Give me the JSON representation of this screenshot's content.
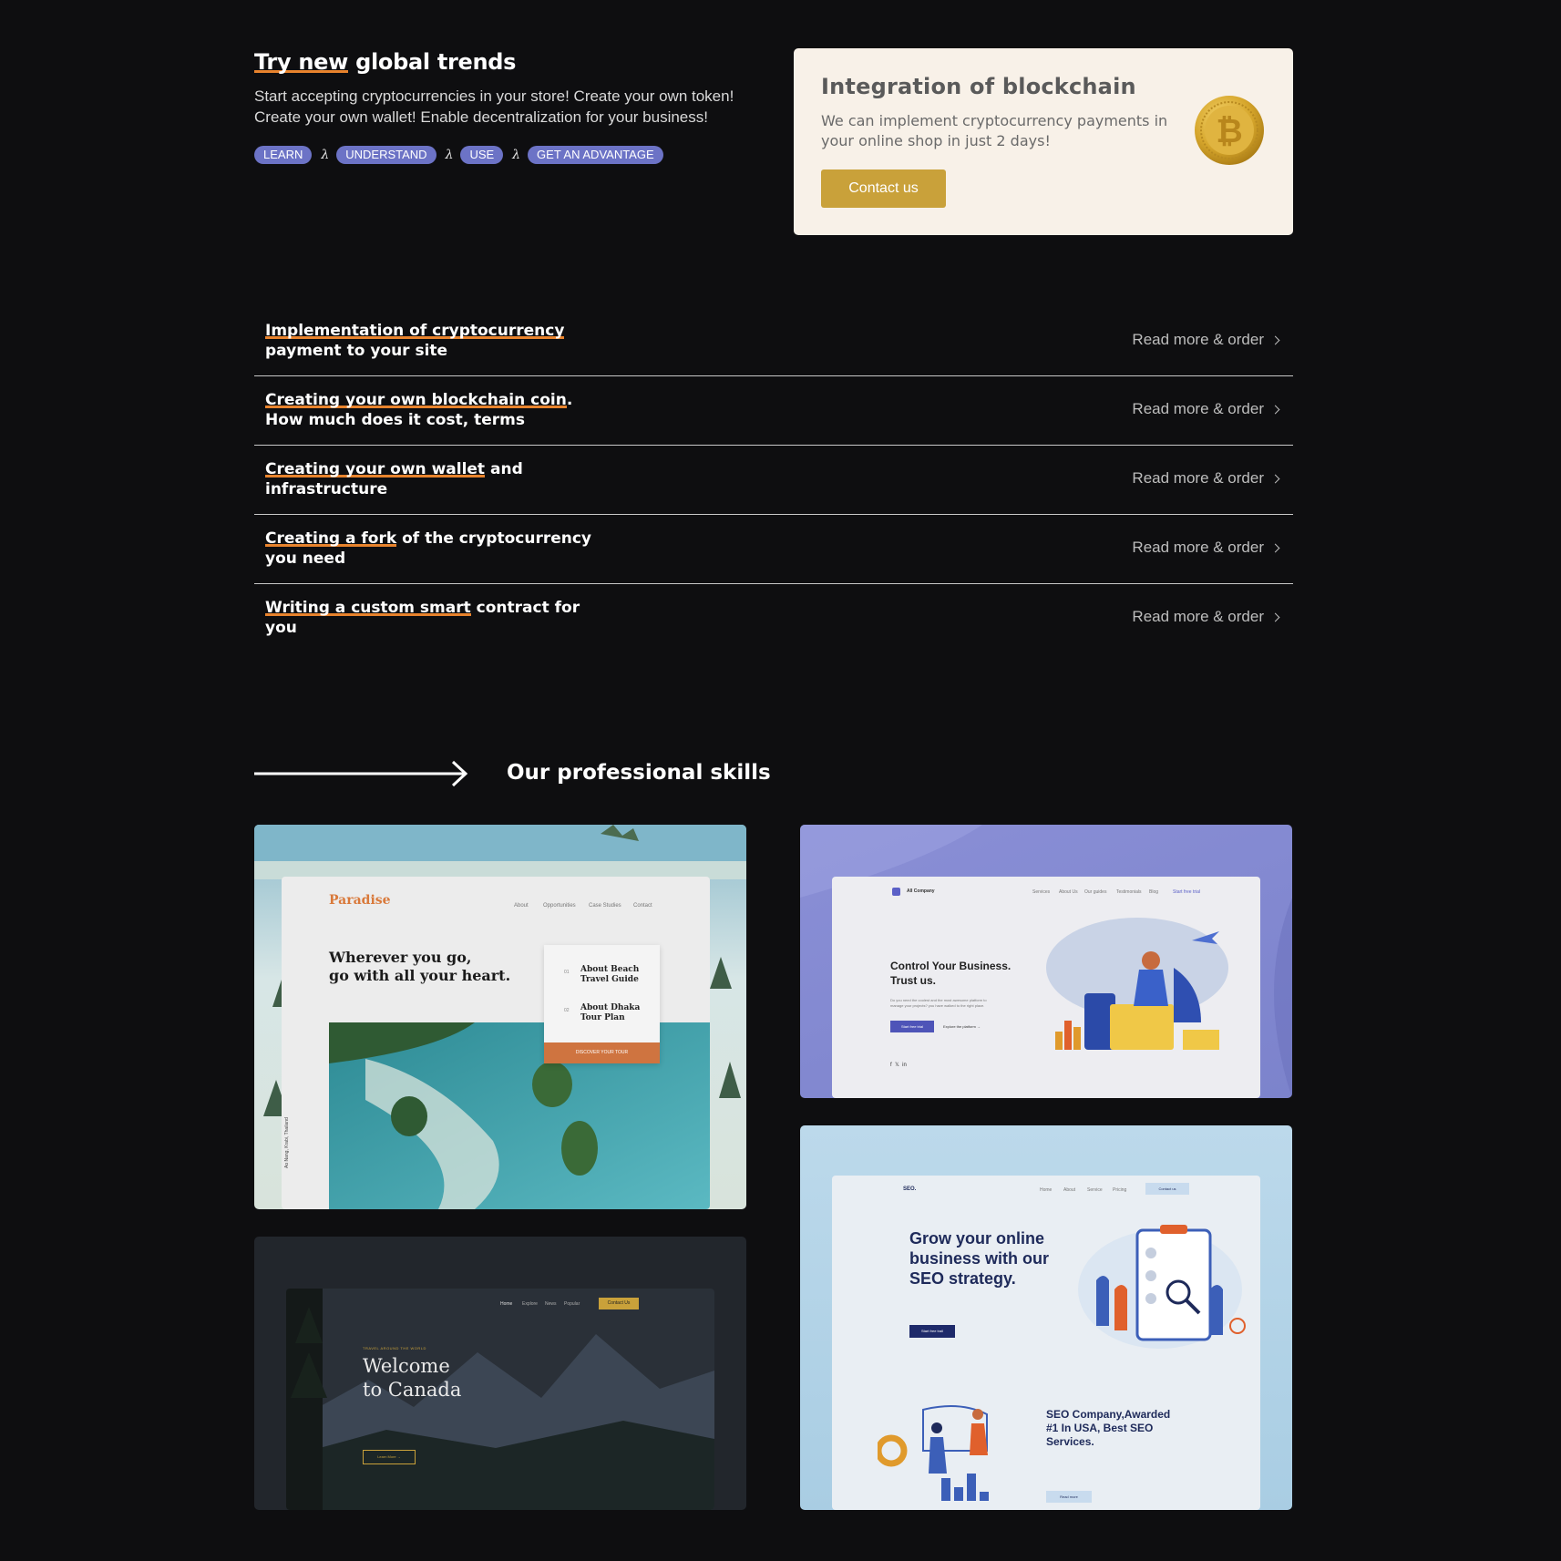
{
  "hero": {
    "title_highlight": "Try new",
    "title_rest": " global trends",
    "description": "Start accepting cryptocurrencies in your store! Create your own token! Create your own wallet! Enable decentralization for your business!",
    "tags": [
      "LEARN",
      "UNDERSTAND",
      "USE",
      "GET AN ADVANTAGE"
    ],
    "tag_separator": "λ"
  },
  "promo": {
    "title": "Integration of blockchain",
    "description": "We can implement cryptocurrency payments in your online shop in just 2 days!",
    "button_label": "Contact us",
    "coin_symbol": "₿",
    "coin_color": "#d6a62c"
  },
  "services": {
    "link_label": "Read more & order",
    "items": [
      {
        "highlight": "Implementation of cryptocurrency",
        "rest": " payment to your site"
      },
      {
        "highlight": "Creating your own blockchain coin",
        "rest": ". How much does it cost, terms"
      },
      {
        "highlight": "Creating your own wallet",
        "rest": " and infrastructure"
      },
      {
        "highlight": "Creating a fork",
        "rest": " of the cryptocurrency you need"
      },
      {
        "highlight": "Writing a custom smart",
        "rest": " contract for you"
      }
    ]
  },
  "skills": {
    "title": "Our professional skills",
    "paradise": {
      "brand": "Paradise",
      "nav": [
        "About",
        "Opportunities",
        "Case Studies",
        "Contact"
      ],
      "headline_1": "Wherever you go,",
      "headline_2": "go with all your heart.",
      "item1_num": "01",
      "item1_1": "About Beach",
      "item1_2": "Travel Guide",
      "item2_num": "02",
      "item2_1": "About Dhaka",
      "item2_2": "Tour Plan",
      "cta": "DISCOVER YOUR TOUR",
      "location": "Ao Nang, Krabi, Thailand"
    },
    "company": {
      "brand": "All Company",
      "nav": [
        "Services",
        "About Us",
        "Our guides",
        "Testimonials",
        "Blog"
      ],
      "nav_cta": "Start free trial",
      "headline_1": "Control Your Business.",
      "headline_2": "Trust us.",
      "sub": "Do you need the coolest and the most awesome platform to manage your projects? you have walked to the right place.",
      "btn_primary": "Start free trial",
      "btn_secondary": "Explore the platform →"
    },
    "canada": {
      "nav": [
        "Home",
        "Explore",
        "News",
        "Popular"
      ],
      "nav_cta": "Contact Us",
      "kicker": "TRAVEL AROUND THE WORLD",
      "headline_1": "Welcome",
      "headline_2": "to Canada",
      "btn": "Learn More →"
    },
    "seo": {
      "brand": "SEO.",
      "nav": [
        "Home",
        "About",
        "Service",
        "Pricing"
      ],
      "nav_cta": "Contact us",
      "headline_1": "Grow your online",
      "headline_2": "business with our",
      "headline_3": "SEO strategy.",
      "btn": "Start free trail",
      "sub_headline_1": "SEO Company,Awarded",
      "sub_headline_2": "#1 In USA, Best SEO",
      "sub_headline_3": "Services.",
      "btn2": "Read more"
    }
  }
}
